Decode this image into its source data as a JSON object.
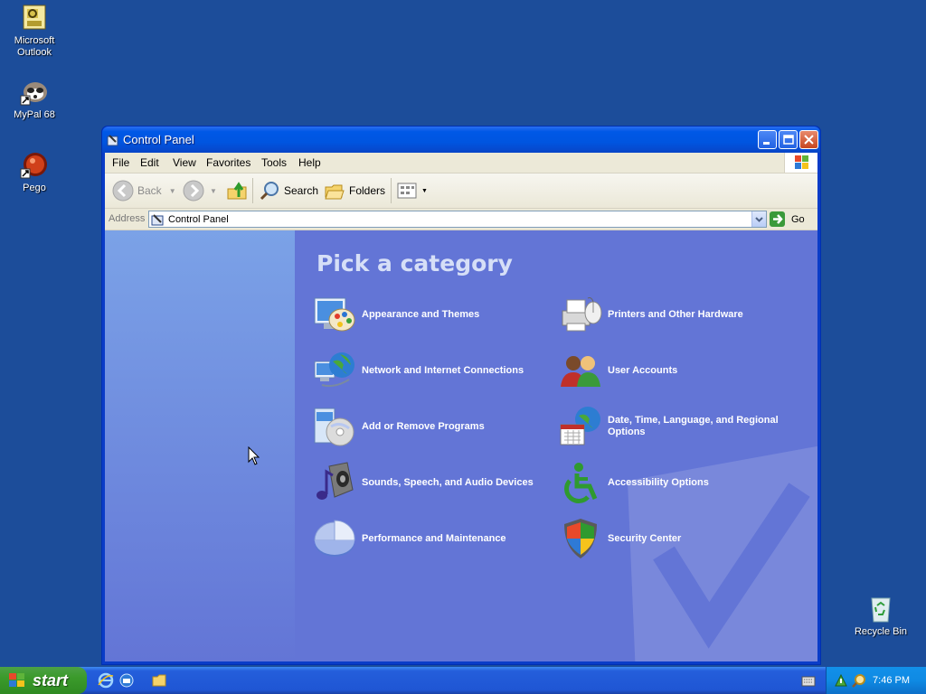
{
  "desktop": {
    "icons": [
      {
        "label_line1": "Microsoft",
        "label_line2": "Outlook"
      },
      {
        "label_line1": "MyPal 68",
        "label_line2": ""
      },
      {
        "label_line1": "Pego",
        "label_line2": ""
      },
      {
        "label_line1": "Recycle Bin",
        "label_line2": ""
      }
    ]
  },
  "window": {
    "title": "Control Panel",
    "menu": [
      "File",
      "Edit",
      "View",
      "Favorites",
      "Tools",
      "Help"
    ],
    "toolbar": {
      "back": "Back",
      "search": "Search",
      "folders": "Folders"
    },
    "address": {
      "label": "Address",
      "value": "Control Panel",
      "go": "Go"
    },
    "heading": "Pick a category",
    "categories": [
      {
        "label": "Appearance and Themes",
        "icon": "appearance-themes-icon"
      },
      {
        "label": "Printers and Other Hardware",
        "icon": "printers-hardware-icon"
      },
      {
        "label": "Network and Internet Connections",
        "icon": "network-internet-icon"
      },
      {
        "label": "User Accounts",
        "icon": "user-accounts-icon"
      },
      {
        "label": "Add or Remove Programs",
        "icon": "add-remove-programs-icon"
      },
      {
        "label": "Date, Time, Language, and Regional Options",
        "icon": "date-time-regional-icon"
      },
      {
        "label": "Sounds, Speech, and Audio Devices",
        "icon": "sounds-audio-icon"
      },
      {
        "label": "Accessibility Options",
        "icon": "accessibility-icon"
      },
      {
        "label": "Performance and Maintenance",
        "icon": "performance-maintenance-icon"
      },
      {
        "label": "Security Center",
        "icon": "security-center-icon"
      }
    ]
  },
  "taskbar": {
    "start": "start",
    "clock": "7:46 PM"
  }
}
